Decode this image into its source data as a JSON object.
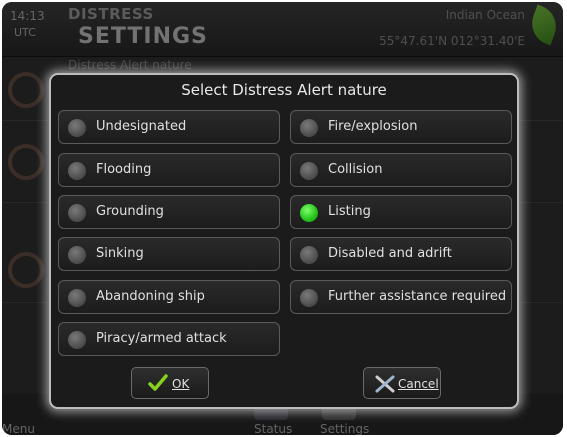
{
  "header": {
    "time": "14:13",
    "timezone": "UTC",
    "subtitle": "DISTRESS",
    "title": "SETTINGS",
    "location_name": "Indian Ocean",
    "coordinates": "55°47.61'N  012°31.40'E"
  },
  "background": {
    "menu_text": "Distress Alert nature"
  },
  "bottom_bar": {
    "menu_label": "Menu",
    "status_label": "Status",
    "settings_label": "Settings"
  },
  "dialog": {
    "title": "Select Distress Alert nature",
    "options": [
      {
        "label": "Undesignated",
        "selected": false
      },
      {
        "label": "Fire/explosion",
        "selected": false
      },
      {
        "label": "Flooding",
        "selected": false
      },
      {
        "label": "Collision",
        "selected": false
      },
      {
        "label": "Grounding",
        "selected": false
      },
      {
        "label": "Listing",
        "selected": true
      },
      {
        "label": "Sinking",
        "selected": false
      },
      {
        "label": "Disabled and adrift",
        "selected": false
      },
      {
        "label": "Abandoning ship",
        "selected": false
      },
      {
        "label": "Further assistance required",
        "selected": false
      },
      {
        "label": "Piracy/armed attack",
        "selected": false
      }
    ],
    "ok_label": "OK",
    "cancel_label": "Cancel"
  },
  "colors": {
    "selected_radio": "#23c21a",
    "unselected_radio": "#5a5a5a",
    "dialog_background": "#1b1b1b",
    "check_icon": "#8ad01e"
  }
}
